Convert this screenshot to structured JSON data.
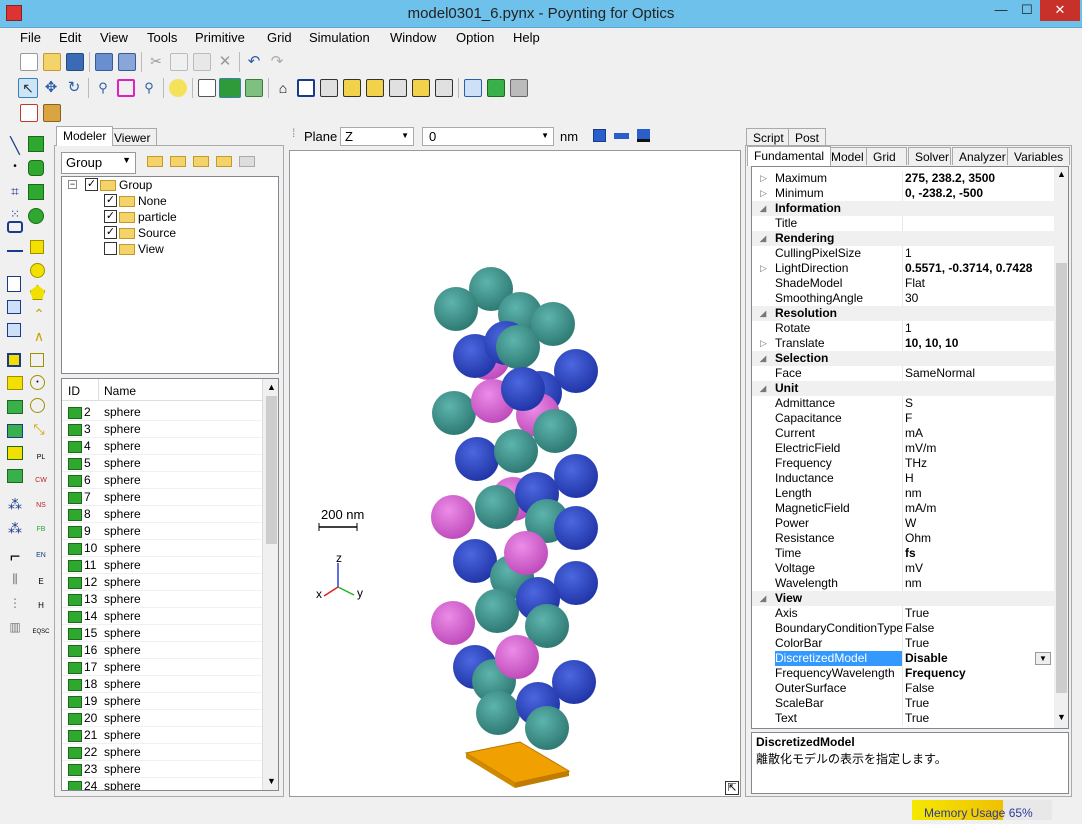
{
  "window": {
    "title": "model0301_6.pynx - Poynting for Optics",
    "minimize": "—",
    "maximize": "☐",
    "close": "✕"
  },
  "menu": [
    "File",
    "Edit",
    "View",
    "Tools",
    "Primitive",
    "Grid",
    "Simulation",
    "Window",
    "Option",
    "Help"
  ],
  "left_tabs": {
    "modeler": "Modeler",
    "viewer": "Viewer"
  },
  "group_select": "Group",
  "tree": {
    "root": "Group",
    "children": [
      {
        "label": "None",
        "checked": true
      },
      {
        "label": "particle",
        "checked": true
      },
      {
        "label": "Source",
        "checked": true
      },
      {
        "label": "View",
        "checked": false
      }
    ]
  },
  "list": {
    "col_id": "ID",
    "col_name": "Name",
    "rows": [
      {
        "id": "2",
        "name": "sphere"
      },
      {
        "id": "3",
        "name": "sphere"
      },
      {
        "id": "4",
        "name": "sphere"
      },
      {
        "id": "5",
        "name": "sphere"
      },
      {
        "id": "6",
        "name": "sphere"
      },
      {
        "id": "7",
        "name": "sphere"
      },
      {
        "id": "8",
        "name": "sphere"
      },
      {
        "id": "9",
        "name": "sphere"
      },
      {
        "id": "10",
        "name": "sphere"
      },
      {
        "id": "11",
        "name": "sphere"
      },
      {
        "id": "12",
        "name": "sphere"
      },
      {
        "id": "13",
        "name": "sphere"
      },
      {
        "id": "14",
        "name": "sphere"
      },
      {
        "id": "15",
        "name": "sphere"
      },
      {
        "id": "16",
        "name": "sphere"
      },
      {
        "id": "17",
        "name": "sphere"
      },
      {
        "id": "18",
        "name": "sphere"
      },
      {
        "id": "19",
        "name": "sphere"
      },
      {
        "id": "20",
        "name": "sphere"
      },
      {
        "id": "21",
        "name": "sphere"
      },
      {
        "id": "22",
        "name": "sphere"
      },
      {
        "id": "23",
        "name": "sphere"
      },
      {
        "id": "24",
        "name": "sphere"
      }
    ]
  },
  "plane_bar": {
    "label": "Plane",
    "axis": "Z",
    "value": "0",
    "unit": "nm"
  },
  "viewport": {
    "scale_label": "200 nm",
    "axis_z": "z",
    "axis_y": "y",
    "axis_x": "x"
  },
  "right_tabs_top": [
    "Script",
    "Post"
  ],
  "right_tabs": [
    "Fundamental",
    "Model",
    "Grid",
    "Solver",
    "Analyzer",
    "Variables"
  ],
  "properties": [
    {
      "type": "item",
      "name": "Maximum",
      "value": "275, 238.2, 3500",
      "bold": true,
      "expand": true
    },
    {
      "type": "item",
      "name": "Minimum",
      "value": "0, -238.2, -500",
      "bold": true,
      "expand": true
    },
    {
      "type": "cat",
      "name": "Information"
    },
    {
      "type": "item",
      "name": "Title",
      "value": ""
    },
    {
      "type": "cat",
      "name": "Rendering"
    },
    {
      "type": "item",
      "name": "CullingPixelSize",
      "value": "1"
    },
    {
      "type": "item",
      "name": "LightDirection",
      "value": "0.5571, -0.3714, 0.7428",
      "bold": true,
      "expand": true
    },
    {
      "type": "item",
      "name": "ShadeModel",
      "value": "Flat"
    },
    {
      "type": "item",
      "name": "SmoothingAngle",
      "value": "30"
    },
    {
      "type": "cat",
      "name": "Resolution"
    },
    {
      "type": "item",
      "name": "Rotate",
      "value": "1"
    },
    {
      "type": "item",
      "name": "Translate",
      "value": "10, 10, 10",
      "bold": true,
      "expand": true
    },
    {
      "type": "cat",
      "name": "Selection"
    },
    {
      "type": "item",
      "name": "Face",
      "value": "SameNormal"
    },
    {
      "type": "cat",
      "name": "Unit"
    },
    {
      "type": "item",
      "name": "Admittance",
      "value": "S"
    },
    {
      "type": "item",
      "name": "Capacitance",
      "value": "F"
    },
    {
      "type": "item",
      "name": "Current",
      "value": "mA"
    },
    {
      "type": "item",
      "name": "ElectricField",
      "value": "mV/m"
    },
    {
      "type": "item",
      "name": "Frequency",
      "value": "THz"
    },
    {
      "type": "item",
      "name": "Inductance",
      "value": "H"
    },
    {
      "type": "item",
      "name": "Length",
      "value": "nm"
    },
    {
      "type": "item",
      "name": "MagneticField",
      "value": "mA/m"
    },
    {
      "type": "item",
      "name": "Power",
      "value": "W"
    },
    {
      "type": "item",
      "name": "Resistance",
      "value": "Ohm"
    },
    {
      "type": "item",
      "name": "Time",
      "value": "fs",
      "bold": true
    },
    {
      "type": "item",
      "name": "Voltage",
      "value": "mV"
    },
    {
      "type": "item",
      "name": "Wavelength",
      "value": "nm"
    },
    {
      "type": "cat",
      "name": "View"
    },
    {
      "type": "item",
      "name": "Axis",
      "value": "True"
    },
    {
      "type": "item",
      "name": "BoundaryConditionType",
      "value": "False"
    },
    {
      "type": "item",
      "name": "ColorBar",
      "value": "True"
    },
    {
      "type": "item",
      "name": "DiscretizedModel",
      "value": "Disable",
      "bold": true,
      "selected": true
    },
    {
      "type": "item",
      "name": "FrequencyWavelength",
      "value": "Frequency",
      "bold": true
    },
    {
      "type": "item",
      "name": "OuterSurface",
      "value": "False"
    },
    {
      "type": "item",
      "name": "ScaleBar",
      "value": "True"
    },
    {
      "type": "item",
      "name": "Text",
      "value": "True"
    }
  ],
  "description": {
    "title": "DiscretizedModel",
    "text": "離散化モデルの表示を指定します。"
  },
  "status": {
    "memory": "Memory Usage 65%",
    "memory_fraction": 0.65
  },
  "colors": {
    "titlebar": "#6dc1ea",
    "close": "#c7312a",
    "teal": "#3a8f8a",
    "blue": "#2f49c4",
    "pink": "#d965d4",
    "source": "#f0a000",
    "selection": "#3399ff"
  }
}
